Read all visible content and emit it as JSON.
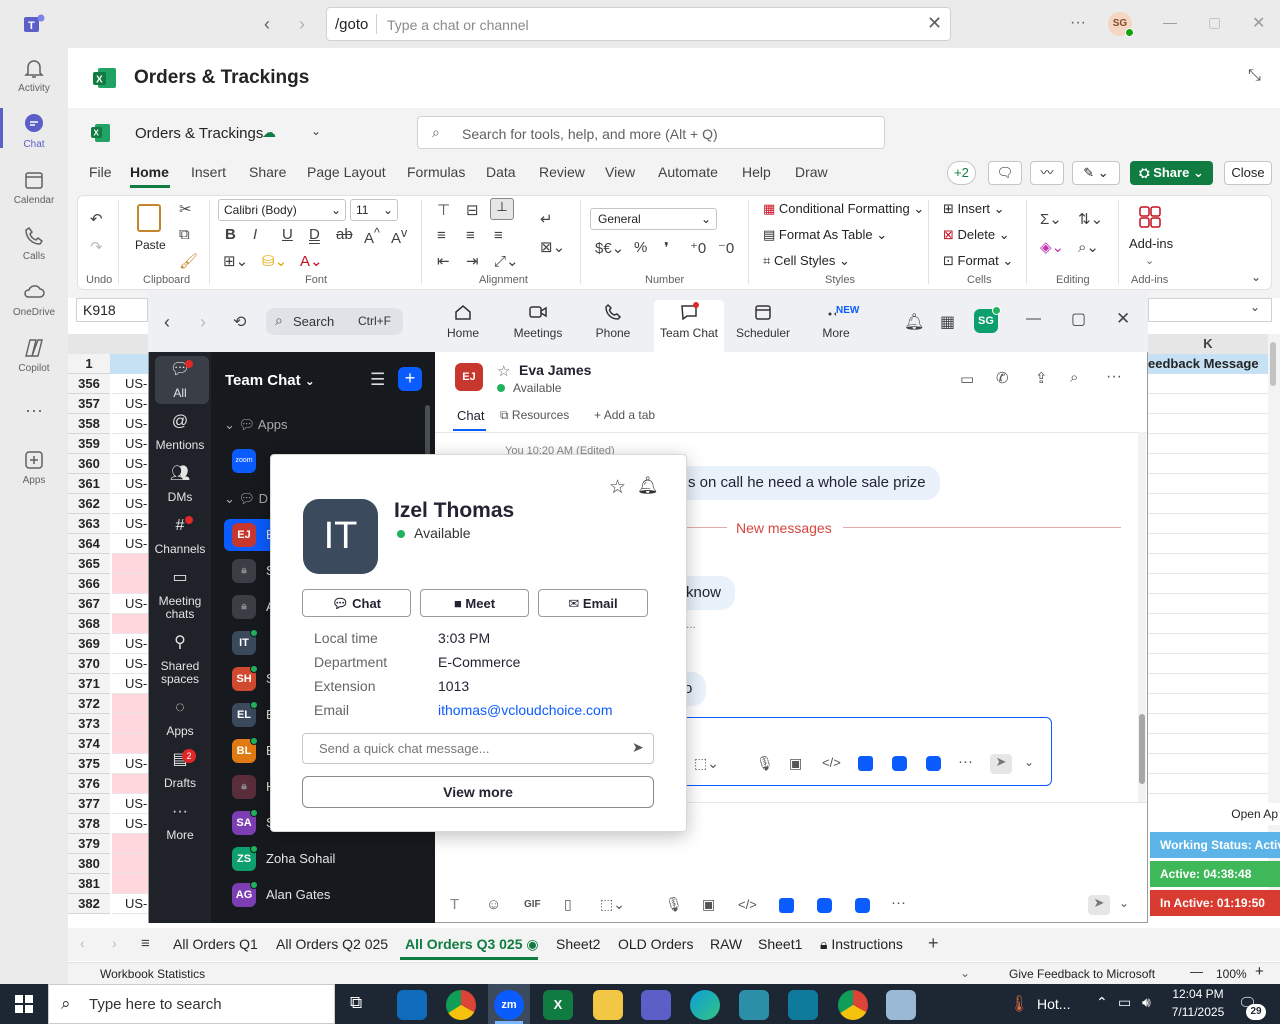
{
  "teams": {
    "search_command": "/goto",
    "search_placeholder": "Type a chat or channel",
    "user_initials": "SG",
    "rail": [
      {
        "label": "Activity",
        "icon": "bell-icon"
      },
      {
        "label": "Chat",
        "icon": "chat-icon"
      },
      {
        "label": "Calendar",
        "icon": "calendar-icon"
      },
      {
        "label": "Calls",
        "icon": "phone-icon"
      },
      {
        "label": "OneDrive",
        "icon": "cloud-icon"
      },
      {
        "label": "Copilot",
        "icon": "copilot-icon"
      },
      {
        "label": "Apps",
        "icon": "apps-icon"
      }
    ]
  },
  "excel": {
    "header_title": "Orders & Trackings",
    "doc_title": "Orders & Trackings",
    "search_placeholder": "Search for tools, help, and more (Alt + Q)",
    "tabs": [
      "File",
      "Home",
      "Insert",
      "Share",
      "Page Layout",
      "Formulas",
      "Data",
      "Review",
      "View",
      "Automate",
      "Help",
      "Draw"
    ],
    "collab_count": "+2",
    "share_label": "Share",
    "close_label": "Close",
    "font_name": "Calibri (Body)",
    "font_size": "11",
    "number_format": "General",
    "paste_label": "Paste",
    "styles": {
      "conditional": "Conditional Formatting",
      "table": "Format As Table",
      "cell": "Cell Styles"
    },
    "cells": {
      "insert": "Insert",
      "delete": "Delete",
      "format": "Format"
    },
    "addins_label": "Add-ins",
    "groups": [
      "Undo",
      "Clipboard",
      "Font",
      "Alignment",
      "Number",
      "Styles",
      "Cells",
      "Editing",
      "Add-ins"
    ],
    "name_box": "K918",
    "col_k": "K",
    "col_k_header": "eedback Message",
    "rows": [
      "1",
      "356",
      "357",
      "358",
      "359",
      "360",
      "361",
      "362",
      "363",
      "364",
      "365",
      "366",
      "367",
      "368",
      "369",
      "370",
      "371",
      "372",
      "373",
      "374",
      "375",
      "376",
      "377",
      "378",
      "379",
      "380",
      "381",
      "382"
    ],
    "cell_prefix": "US-",
    "sheet_tabs": [
      "All Orders Q1",
      "All Orders Q2 025",
      "All Orders Q3 025",
      "Sheet2",
      "OLD Orders",
      "RAW",
      "Sheet1",
      "Instructions"
    ],
    "status_left": "Workbook Statistics",
    "status_feedback": "Give Feedback to Microsoft",
    "zoom_level": "100%",
    "side_panel": {
      "open": "Open Ap",
      "working": "Working Status: Activ",
      "active": "Active: 04:38:48",
      "inactive": "In Active: 01:19:50"
    }
  },
  "zoom": {
    "search_label": "Search",
    "search_shortcut": "Ctrl+F",
    "nav": [
      "Home",
      "Meetings",
      "Phone",
      "Team Chat",
      "Scheduler",
      "More"
    ],
    "new_badge": "NEW",
    "user_initials": "SG",
    "sidebar": [
      {
        "label": "All"
      },
      {
        "label": "Mentions"
      },
      {
        "label": "DMs"
      },
      {
        "label": "Channels"
      },
      {
        "label": "Meeting chats"
      },
      {
        "label": "Shared spaces"
      },
      {
        "label": "Apps"
      },
      {
        "label": "Drafts"
      },
      {
        "label": "More"
      }
    ],
    "drafts_badge": "2",
    "panel_title": "Team Chat",
    "section_apps": "Apps",
    "section_d": "D",
    "zoom_app_label": "zoom",
    "chat_list": [
      {
        "initials": "EJ",
        "color": "#c8372d",
        "letter": "E"
      },
      {
        "initials": "",
        "color": "#3b3f45",
        "letter": "S"
      },
      {
        "initials": "",
        "color": "#3b3f45",
        "letter": "A"
      },
      {
        "initials": "IT",
        "color": "#3a4a5c",
        "letter": ""
      },
      {
        "initials": "SH",
        "color": "#d14a2f",
        "letter": "S"
      },
      {
        "initials": "EL",
        "color": "#3a4a5c",
        "letter": "E"
      },
      {
        "initials": "BL",
        "color": "#e07a13",
        "letter": "E"
      },
      {
        "initials": "",
        "color": "#5a2d3b",
        "letter": "H"
      },
      {
        "initials": "SA",
        "color": "#7b3fb3",
        "letter": "S"
      },
      {
        "initials": "ZS",
        "color": "#0d9f6e",
        "name": "Zoha Sohail"
      },
      {
        "initials": "AG",
        "color": "#7b3fb3",
        "name": "Alan Gates"
      }
    ],
    "contact_name": "Eva James",
    "contact_initials": "EJ",
    "contact_status": "Available",
    "chat_tabs": [
      "Chat",
      "Resources",
      "Add a tab"
    ],
    "msg_meta": "You 10:20 AM (Edited)",
    "msg1": "s on call he need a whole sale prize",
    "new_messages": "New messages",
    "msg2": "know",
    "msg3": "o"
  },
  "profile": {
    "initials": "IT",
    "name": "Izel Thomas",
    "status": "Available",
    "buttons": [
      "Chat",
      "Meet",
      "Email"
    ],
    "fields": [
      {
        "label": "Local time",
        "value": "3:03 PM"
      },
      {
        "label": "Department",
        "value": "E-Commerce"
      },
      {
        "label": "Extension",
        "value": "1013"
      },
      {
        "label": "Email",
        "value": "ithomas@vcloudchoice.com"
      }
    ],
    "quick_placeholder": "Send a quick chat message...",
    "view_more": "View more"
  },
  "taskbar": {
    "search_placeholder": "Type here to search",
    "weather": "Hot...",
    "time": "12:04 PM",
    "date": "7/11/2025",
    "notif_count": "29"
  }
}
